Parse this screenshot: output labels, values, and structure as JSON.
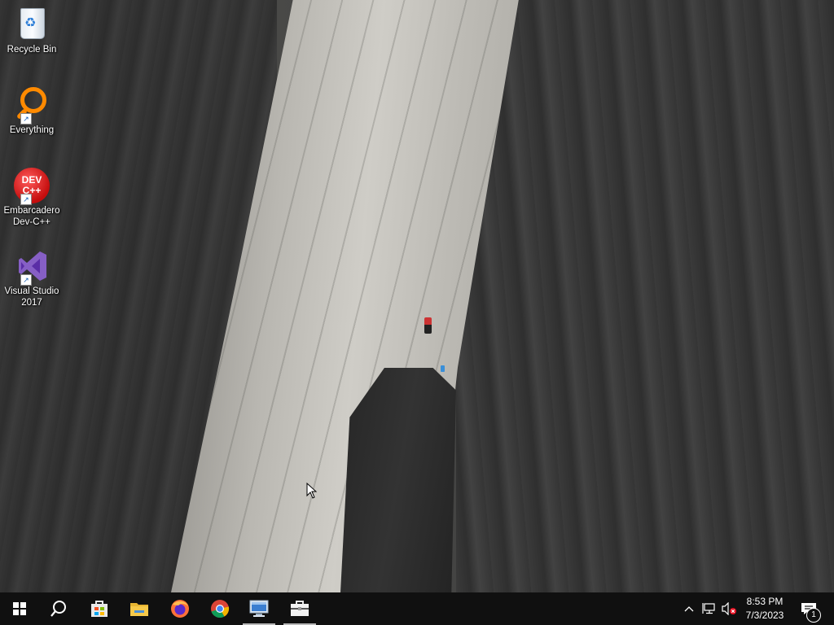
{
  "desktop": {
    "icons": [
      {
        "label": "Recycle Bin",
        "icon": "recycle-bin-icon"
      },
      {
        "label": "Everything",
        "icon": "everything-search-icon"
      },
      {
        "label": "Embarcadero Dev-C++",
        "icon": "dev-cpp-icon",
        "badge_text": "DEV C++"
      },
      {
        "label": "Visual Studio 2017",
        "icon": "visual-studio-icon"
      }
    ]
  },
  "taskbar": {
    "apps": [
      {
        "name": "Start",
        "icon": "windows-icon"
      },
      {
        "name": "Search",
        "icon": "search-icon"
      },
      {
        "name": "Microsoft Store",
        "icon": "store-icon"
      },
      {
        "name": "File Explorer",
        "icon": "folder-icon"
      },
      {
        "name": "Firefox",
        "icon": "firefox-icon"
      },
      {
        "name": "Google Chrome",
        "icon": "chrome-icon"
      },
      {
        "name": "Remote Desktop",
        "icon": "remote-desktop-icon"
      },
      {
        "name": "Briefcase",
        "icon": "briefcase-icon"
      }
    ],
    "tray": {
      "time": "8:53 PM",
      "date": "7/3/2023",
      "notification_count": "1"
    }
  },
  "colors": {
    "taskbar": "#101010",
    "accent_orange": "#ff8a00",
    "dev_red": "#c40d0d",
    "vs_purple": "#865fc5"
  }
}
